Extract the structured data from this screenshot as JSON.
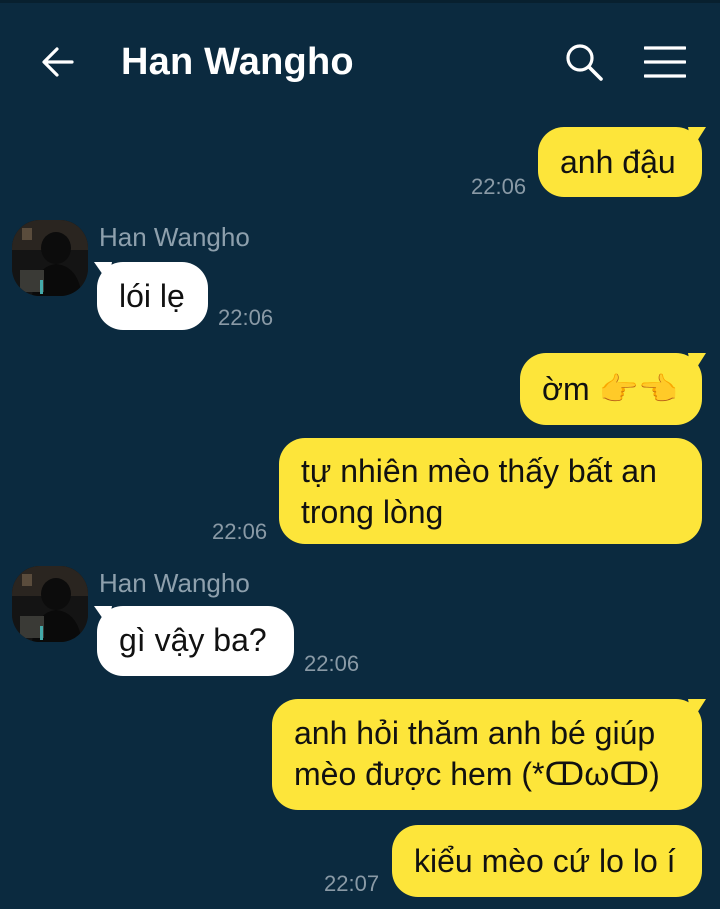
{
  "header": {
    "title": "Han Wangho",
    "back_icon": "arrow-left-icon",
    "search_icon": "search-icon",
    "menu_icon": "hamburger-menu-icon"
  },
  "colors": {
    "background": "#0b2a3f",
    "outgoing_bubble": "#fde53a",
    "incoming_bubble": "#ffffff",
    "timestamp": "#8a9aa6",
    "sender_name": "#8ea0ad"
  },
  "messages": [
    {
      "direction": "out",
      "text": "anh đậu",
      "time": "22:06"
    },
    {
      "direction": "in",
      "sender": "Han Wangho",
      "text": "lói lẹ",
      "time": "22:06"
    },
    {
      "direction": "out",
      "text": "ờm 👉👈",
      "time": ""
    },
    {
      "direction": "out",
      "text": "tự nhiên mèo thấy bất an trong lòng",
      "time": "22:06"
    },
    {
      "direction": "in",
      "sender": "Han Wangho",
      "text": "gì vậy ba?",
      "time": "22:06"
    },
    {
      "direction": "out",
      "text": "anh hỏi thăm anh bé giúp mèo được hem (*ↀωↀ)",
      "time": ""
    },
    {
      "direction": "out",
      "text": "kiểu mèo cứ lo lo í",
      "time": "22:07"
    }
  ]
}
